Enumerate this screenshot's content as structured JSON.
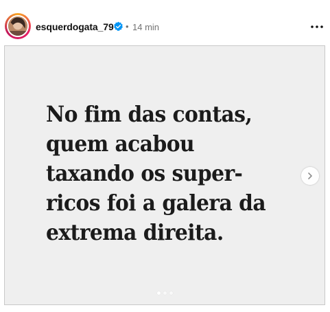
{
  "post": {
    "author": {
      "username": "esquerdogata_79",
      "verified": true,
      "verified_icon": "verified-badge-icon",
      "avatar_icon": "avatar-photo"
    },
    "separator": "•",
    "timestamp": "14 min",
    "more_icon": "more-options-icon",
    "media": {
      "lines": [
        "No fim das contas,",
        "quem acabou",
        "taxando os super-",
        "ricos foi a galera da",
        "extrema direita."
      ],
      "background_color": "#efefef",
      "text_color": "#1b1b1b",
      "next_icon": "chevron-right-icon",
      "carousel": {
        "total": 3,
        "active_index": 0
      }
    }
  },
  "colors": {
    "verified_blue": "#0095f6",
    "secondary_text": "#737373"
  }
}
